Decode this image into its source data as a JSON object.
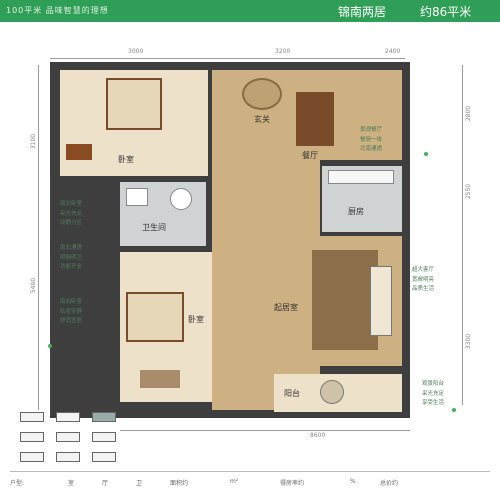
{
  "header": {
    "tagline": "100平米 品味智慧的理想",
    "layout_name": "锦南两居",
    "area_text": "约86平米"
  },
  "dimensions": {
    "top": [
      "3000",
      "3200",
      "2400"
    ],
    "bottom": "8600",
    "left": [
      "3100",
      "5400"
    ],
    "right": [
      "2800",
      "2550",
      "3300"
    ]
  },
  "rooms": {
    "bedroom_1": "卧室",
    "foyer": "玄关",
    "dining": "餐厅",
    "bathroom": "卫生间",
    "kitchen": "厨房",
    "bedroom_2": "卧室",
    "living": "起居室",
    "balcony": "阳台"
  },
  "notes": {
    "top_right": [
      "景观餐厅",
      "餐厨一体",
      "北南通透"
    ],
    "left_a": [
      "南北卧室",
      "采光充足",
      "动静分区"
    ],
    "left_b": [
      "南北通透",
      "明厨明卫",
      "功能齐全"
    ],
    "left_c": [
      "南向卧室",
      "私密安静",
      "舒适宜居"
    ],
    "right_mid": [
      "超大客厅",
      "宽敞明亮",
      "品质生活"
    ],
    "right_low": [
      "观景阳台",
      "采光充足",
      "享受生活"
    ]
  },
  "footer": {
    "label_1": "户型:",
    "label_2": "室",
    "label_3": "厅",
    "label_4": "卫",
    "label_5": "面积约",
    "unit": "m²",
    "label_6": "得房率约",
    "label_7": "%",
    "label_8": "总价约"
  },
  "colors": {
    "header": "#2f9e56",
    "wall": "#3e3e3e",
    "wood_floor": "#cdb183",
    "note_text": "#4f7c5a"
  }
}
